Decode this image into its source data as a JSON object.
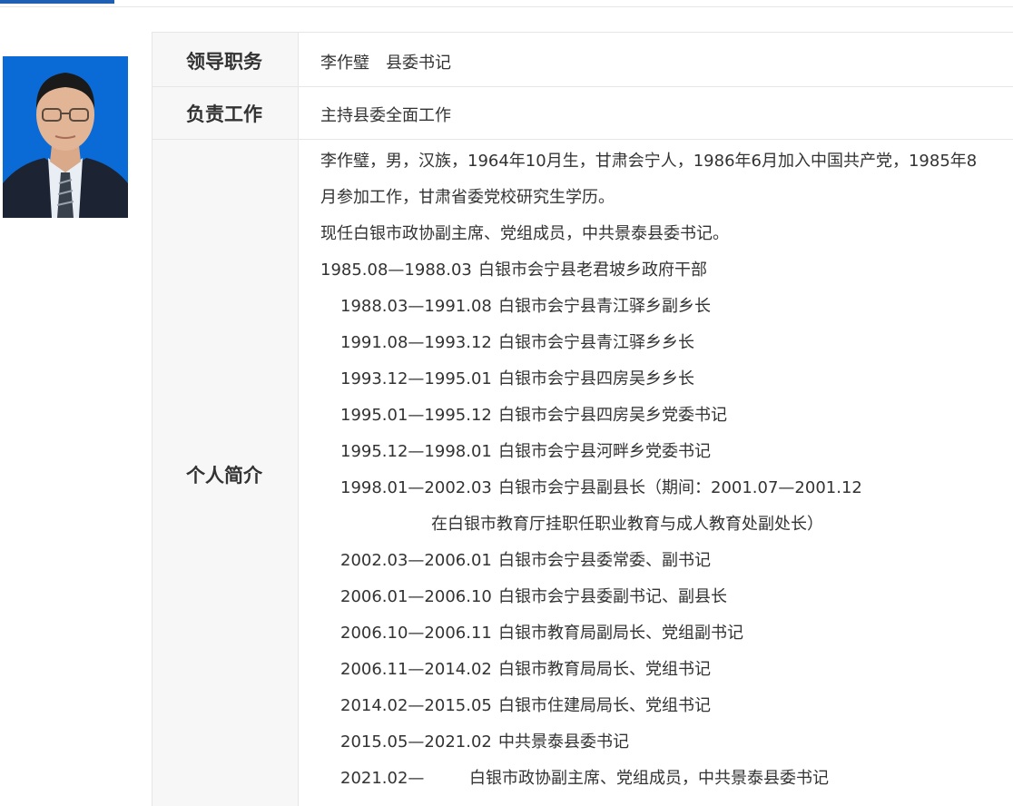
{
  "profile": {
    "photo": {
      "icon": "portrait-photo",
      "bg_color": "#0a6ad6"
    },
    "rows": [
      {
        "label": "领导职务",
        "value": "李作璧　县委书记"
      },
      {
        "label": "负责工作",
        "value": "主持县委全面工作"
      }
    ],
    "bio_label": "个人简介",
    "bio_lines": [
      "李作璧，男，汉族，1964年10月生，甘肃会宁人，1986年6月加入中国共产党，1985年8",
      "月参加工作，甘肃省委党校研究生学历。",
      "现任白银市政协副主席、党组成员，中共景泰县委书记。"
    ],
    "career": [
      {
        "period": "1985.08—1988.03",
        "post": "白银市会宁县老君坡乡政府干部"
      },
      {
        "period": "1988.03—1991.08",
        "post": "白银市会宁县青江驿乡副乡长"
      },
      {
        "period": "1991.08—1993.12",
        "post": "白银市会宁县青江驿乡乡长"
      },
      {
        "period": "1993.12—1995.01",
        "post": "白银市会宁县四房吴乡乡长"
      },
      {
        "period": "1995.01—1995.12",
        "post": "白银市会宁县四房吴乡党委书记"
      },
      {
        "period": "1995.12—1998.01",
        "post": "白银市会宁县河畔乡党委书记"
      },
      {
        "period": "1998.01—2002.03",
        "post": "白银市会宁县副县长（期间：2001.07—2001.12"
      },
      {
        "period": "",
        "post": "在白银市教育厅挂职任职业教育与成人教育处副处长）"
      },
      {
        "period": "2002.03—2006.01",
        "post": "白银市会宁县委常委、副书记"
      },
      {
        "period": "2006.01—2006.10",
        "post": "白银市会宁县委副书记、副县长"
      },
      {
        "period": "2006.10—2006.11",
        "post": "白银市教育局副局长、党组副书记"
      },
      {
        "period": "2006.11—2014.02",
        "post": "白银市教育局局长、党组书记"
      },
      {
        "period": "2014.02—2015.05",
        "post": "白银市住建局局长、党组书记"
      },
      {
        "period": "2015.05—2021.02",
        "post": "中共景泰县委书记"
      },
      {
        "period": "2021.02—",
        "post": "白银市政协副主席、党组成员，中共景泰县委书记"
      }
    ]
  }
}
